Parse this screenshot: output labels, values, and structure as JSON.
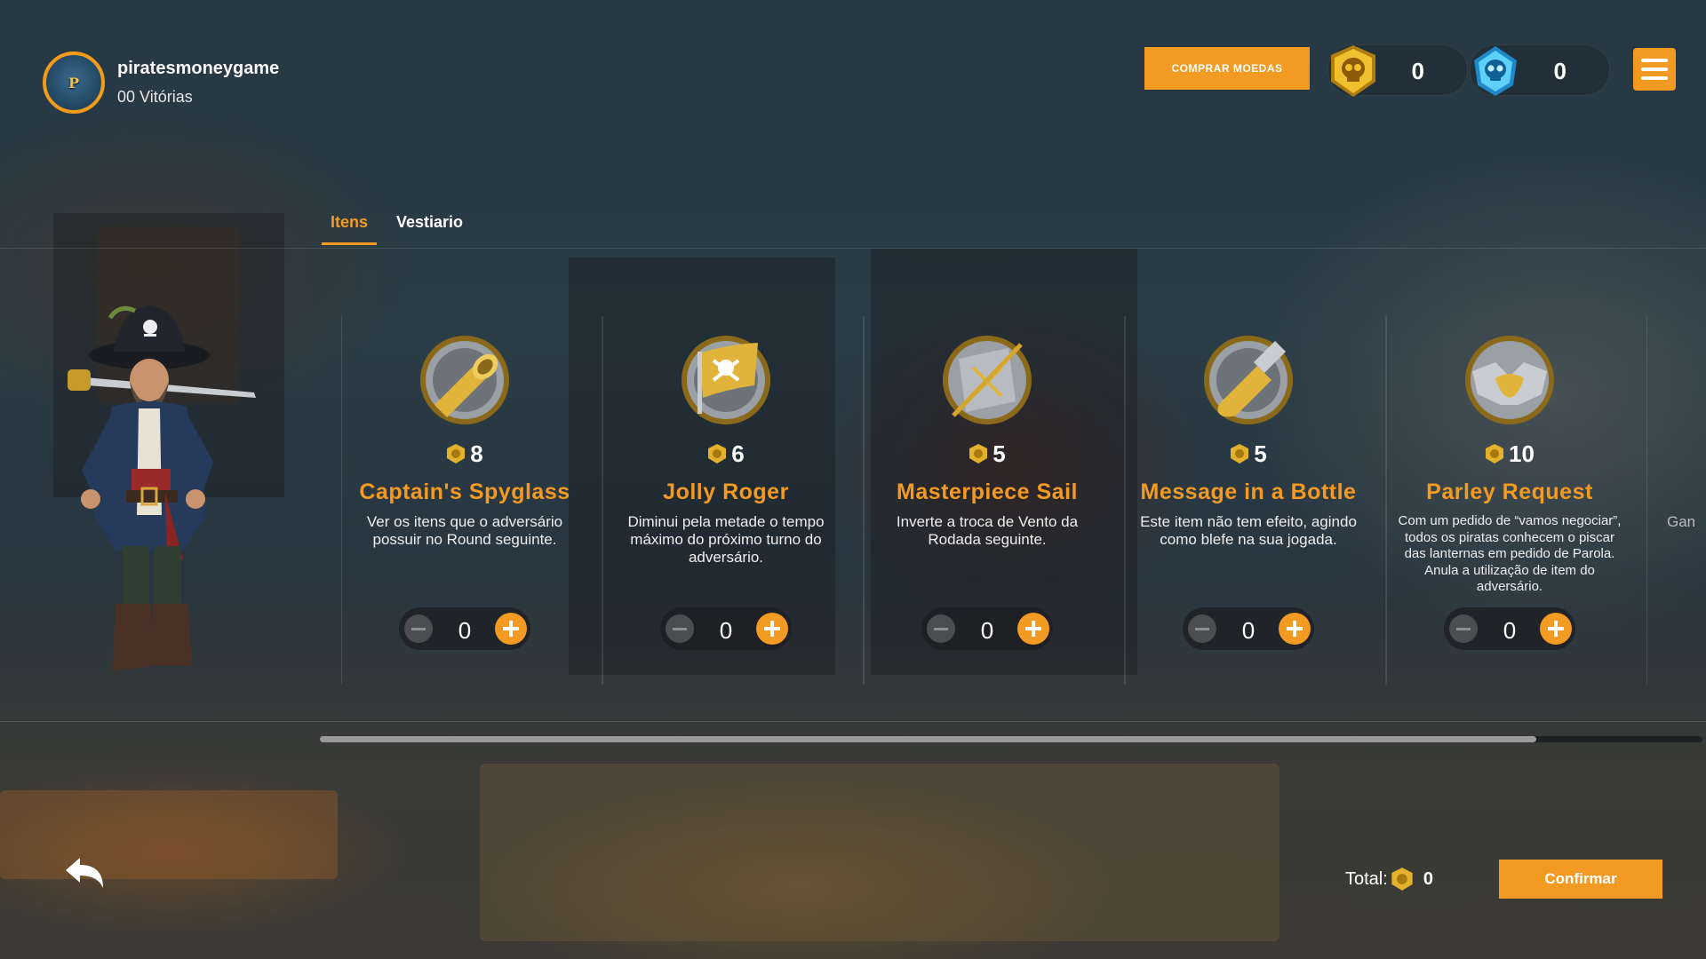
{
  "colors": {
    "accent": "#f39a22",
    "gold": "#e3b12c",
    "gem": "#4fc3f7"
  },
  "profile": {
    "username": "piratesmoneygame",
    "wins": "00 Vitórias",
    "avatar_icon": "pirates-logo-icon"
  },
  "header": {
    "buy_label": "COMPRAR MOEDAS",
    "coins": {
      "icon": "skull-coin-icon",
      "value": "0"
    },
    "gems": {
      "icon": "skull-gem-icon",
      "value": "0"
    },
    "menu_icon": "hamburger-menu-icon"
  },
  "tabs": [
    {
      "label": "Itens",
      "active": true
    },
    {
      "label": "Vestiario",
      "active": false
    }
  ],
  "items": [
    {
      "icon": "spyglass-icon",
      "price": "8",
      "title": "Captain's Spyglass",
      "desc": "Ver os itens que o adversário possuir no Round seguinte.",
      "qty": "0"
    },
    {
      "icon": "jolly-roger-flag-icon",
      "price": "6",
      "title": "Jolly Roger",
      "desc": "Diminui pela metade o tempo máximo do próximo turno do adversário.",
      "qty": "0"
    },
    {
      "icon": "sail-icon",
      "price": "5",
      "title": "Masterpiece Sail",
      "desc": "Inverte a troca de Vento da Rodada seguinte.",
      "qty": "0"
    },
    {
      "icon": "bottle-icon",
      "price": "5",
      "title": "Message in a Bottle",
      "desc": "Este item não tem efeito, agindo como blefe na sua jogada.",
      "qty": "0"
    },
    {
      "icon": "handshake-icon",
      "price": "10",
      "title": "Parley Request",
      "desc": "Com um pedido de “vamos negociar”, todos os piratas conhecem o piscar das lanternas em pedido de Parola. Anula a utilização de item do adversário.",
      "qty": "0"
    }
  ],
  "partial_next": "Gan",
  "scroll": {
    "position": 0.88
  },
  "footer": {
    "total_label": "Total:",
    "total_value": "0",
    "confirm_label": "Confirmar",
    "back_icon": "back-arrow-icon"
  }
}
